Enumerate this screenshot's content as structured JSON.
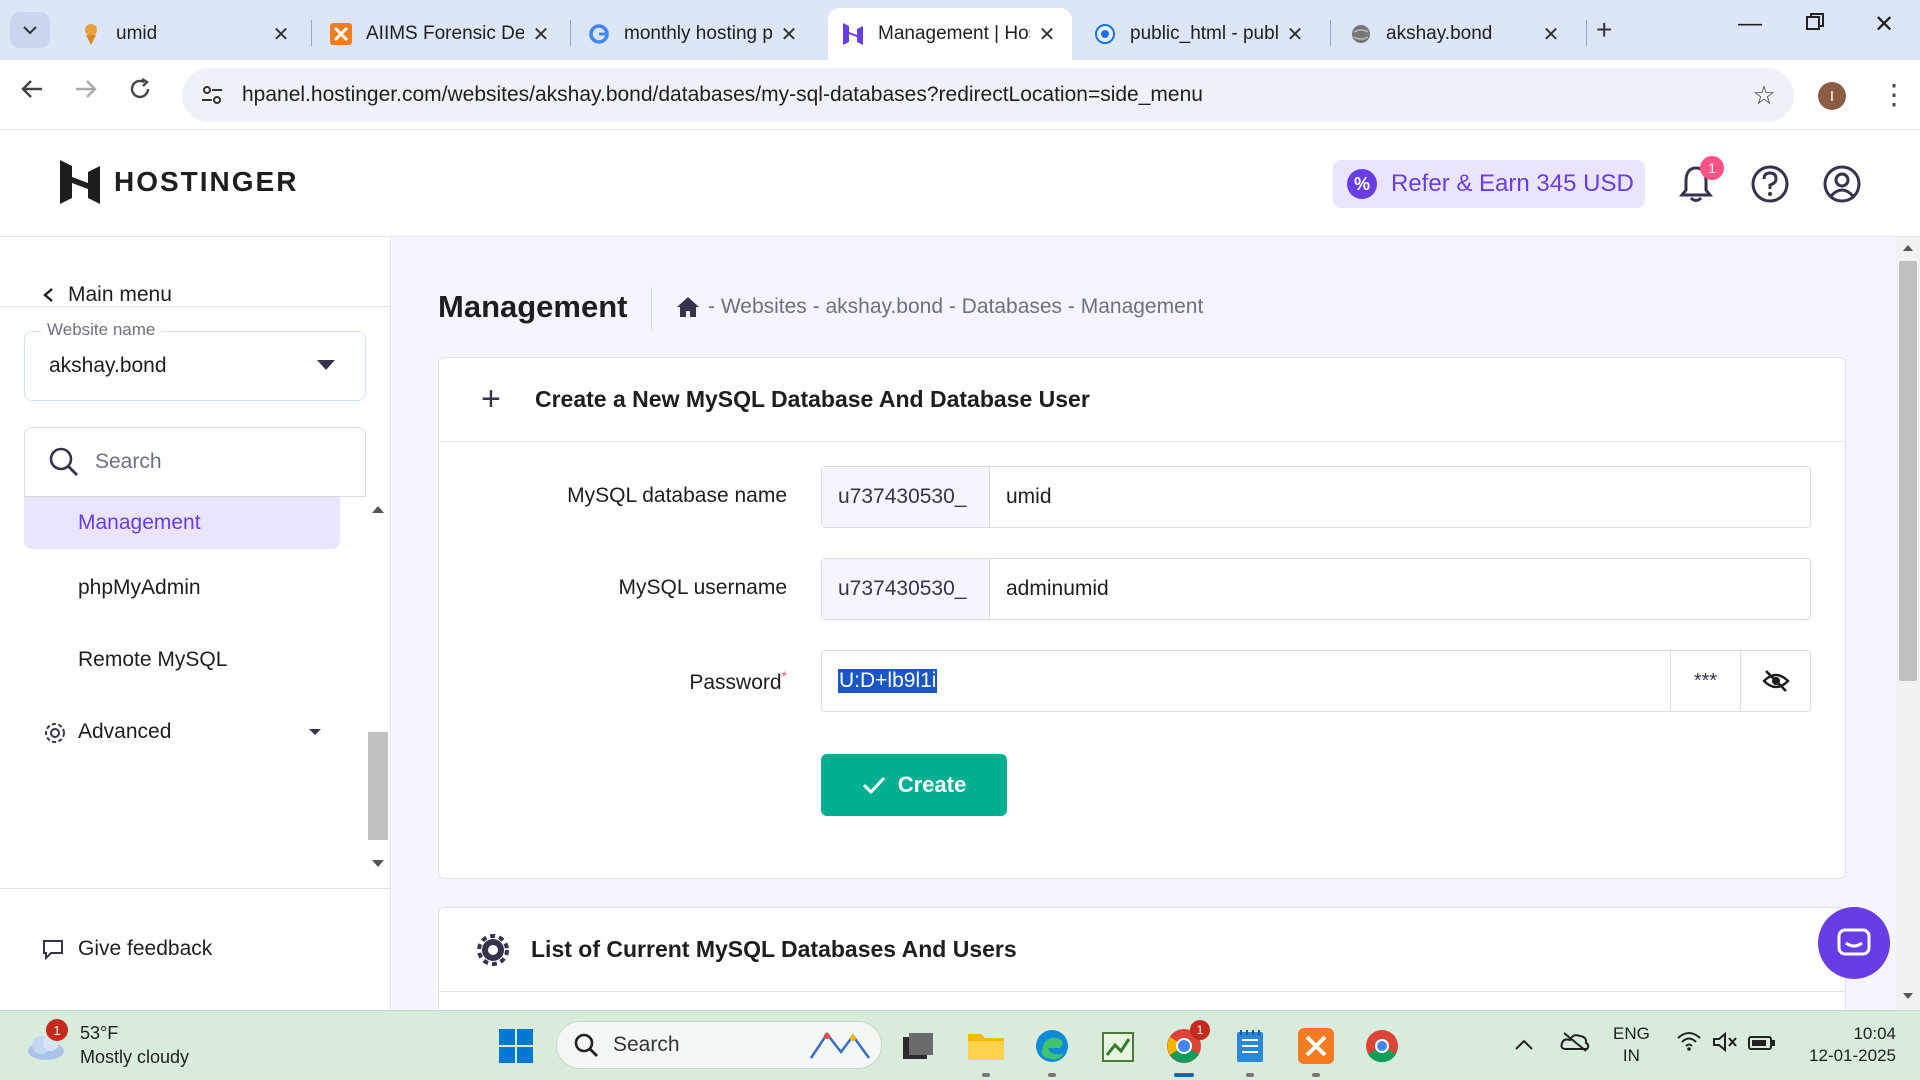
{
  "browser": {
    "tabs": [
      {
        "title": "umid",
        "favicon": "umid-favicon-icon"
      },
      {
        "title": "AIIMS Forensic Dep",
        "favicon": "xampp-icon"
      },
      {
        "title": "monthly hosting p",
        "favicon": "google-icon"
      },
      {
        "title": "Management | Hos",
        "favicon": "hostinger-icon"
      },
      {
        "title": "public_html - publ",
        "favicon": "globe-icon"
      },
      {
        "title": "akshay.bond",
        "favicon": "globe-gray-icon"
      }
    ],
    "url": "hpanel.hostinger.com/websites/akshay.bond/databases/my-sql-databases?redirectLocation=side_menu",
    "profile_initial": "I"
  },
  "header": {
    "logo_text": "HOSTINGER",
    "refer_label": "Refer & Earn 345 USD",
    "notification_count": "1"
  },
  "sidebar": {
    "main_menu_label": "Main menu",
    "website_field_label": "Website name",
    "website_value": "akshay.bond",
    "search_placeholder": "Search",
    "items": [
      {
        "label": "Management",
        "active": true
      },
      {
        "label": "phpMyAdmin",
        "active": false
      },
      {
        "label": "Remote MySQL",
        "active": false
      }
    ],
    "advanced_label": "Advanced",
    "feedback_label": "Give feedback"
  },
  "main": {
    "page_title": "Management",
    "breadcrumb": "- Websites - akshay.bond - Databases - Management",
    "create_card": {
      "title": "Create a New MySQL Database And Database User",
      "db_name_label": "MySQL database name",
      "db_prefix": "u737430530_",
      "db_name_value": "umid",
      "username_label": "MySQL username",
      "username_prefix": "u737430530_",
      "username_value": "adminumid",
      "password_label": "Password",
      "password_required_mark": "*",
      "password_value": "U:D+lb9l1i",
      "generate_button": "***",
      "create_button": "Create"
    },
    "list_card": {
      "title": "List of Current MySQL Databases And Users"
    }
  },
  "taskbar": {
    "weather_temp": "53°F",
    "weather_desc": "Mostly cloudy",
    "weather_badge": "1",
    "search_placeholder": "Search",
    "chrome_badge": "1",
    "lang_line1": "ENG",
    "lang_line2": "IN",
    "time": "10:04",
    "date": "12-01-2025"
  },
  "colors": {
    "brand_purple": "#673de6",
    "create_green": "#00b090",
    "selection_blue": "#1a56c4"
  }
}
